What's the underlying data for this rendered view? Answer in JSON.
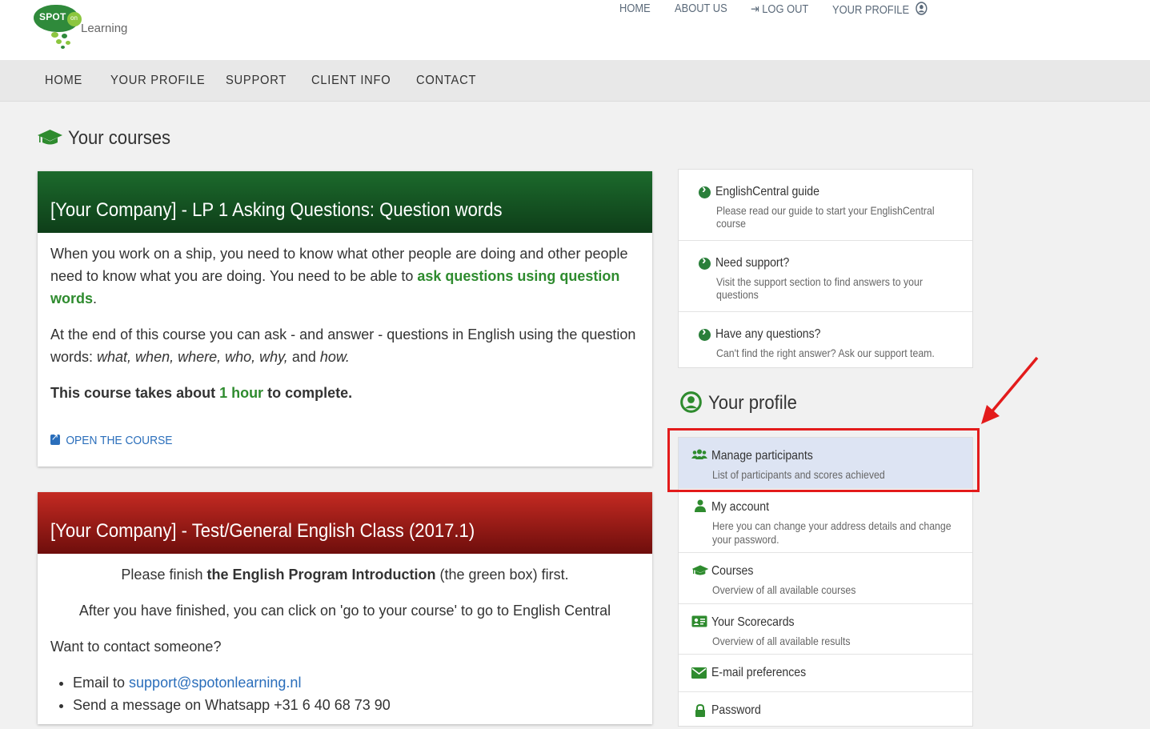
{
  "logo": {
    "spot": "SPOT",
    "on": "on",
    "learning": "Learning"
  },
  "topnav": {
    "home": "HOME",
    "about": "ABOUT US",
    "logout": "LOG OUT",
    "profile": "YOUR PROFILE"
  },
  "mainnav": [
    "HOME",
    "YOUR PROFILE",
    "SUPPORT",
    "CLIENT INFO",
    "CONTACT"
  ],
  "courses": {
    "heading": "Your courses",
    "card1": {
      "title": "[Your Company] - LP 1 Asking Questions: Question words",
      "p1_a": "When you work on a ship, you need to know what other people are doing and other people need to know what you are doing. You need to be able to ",
      "p1_hl": "ask questions using question words",
      "p1_end": ".",
      "p2_a": "At the end of this course  you can ask - and answer - questions in English using the question words: ",
      "p2_words": "what, when, where, who, why,",
      "p2_and": " and ",
      "p2_how": "how.",
      "p3_a": "This course takes about ",
      "p3_hl": "1 hour",
      "p3_b": " to complete.",
      "open_link": "OPEN THE COURSE"
    },
    "card2": {
      "title": "[Your Company] - Test/General English Class (2017.1)",
      "p1_a": "Please finish ",
      "p1_b": "the English Program Introduction",
      "p1_c": " (the green box) first.",
      "p2": "After you have finished, you can click on 'go to your course' to go to English Central",
      "p3": "Want to contact someone?",
      "li1_a": "Email to ",
      "li1_email": "support@spotonlearning.nl",
      "li2": "Send a message on Whatsapp +31 6 40 68 73 90"
    }
  },
  "support_list": [
    {
      "label": "EnglishCentral guide",
      "desc": "Please read our guide to start your EnglishCentral course"
    },
    {
      "label": "Need support?",
      "desc": "Visit the support section to find answers to your questions"
    },
    {
      "label": "Have any questions?",
      "desc": "Can't find the right answer? Ask our support team."
    }
  ],
  "profile": {
    "heading": "Your profile",
    "items": [
      {
        "label": "Manage participants",
        "desc": "List of participants and scores achieved",
        "icon": "users-icon"
      },
      {
        "label": "My account",
        "desc": "Here you can change your address details and change your password.",
        "icon": "user-icon"
      },
      {
        "label": "Courses",
        "desc": "Overview of all available courses",
        "icon": "graduation-cap-icon"
      },
      {
        "label": "Your Scorecards",
        "desc": "Overview of all available results",
        "icon": "id-card-icon"
      },
      {
        "label": "E-mail preferences",
        "desc": "",
        "icon": "envelope-icon"
      },
      {
        "label": "Password",
        "desc": "",
        "icon": "lock-icon"
      }
    ]
  },
  "colors": {
    "brand_green": "#2e8b2e",
    "card_green": "#1c6a2c",
    "card_red": "#c42a22",
    "link_blue": "#2a6ebb",
    "annotation_red": "#e31b1b",
    "highlight": "#dde4f3"
  }
}
